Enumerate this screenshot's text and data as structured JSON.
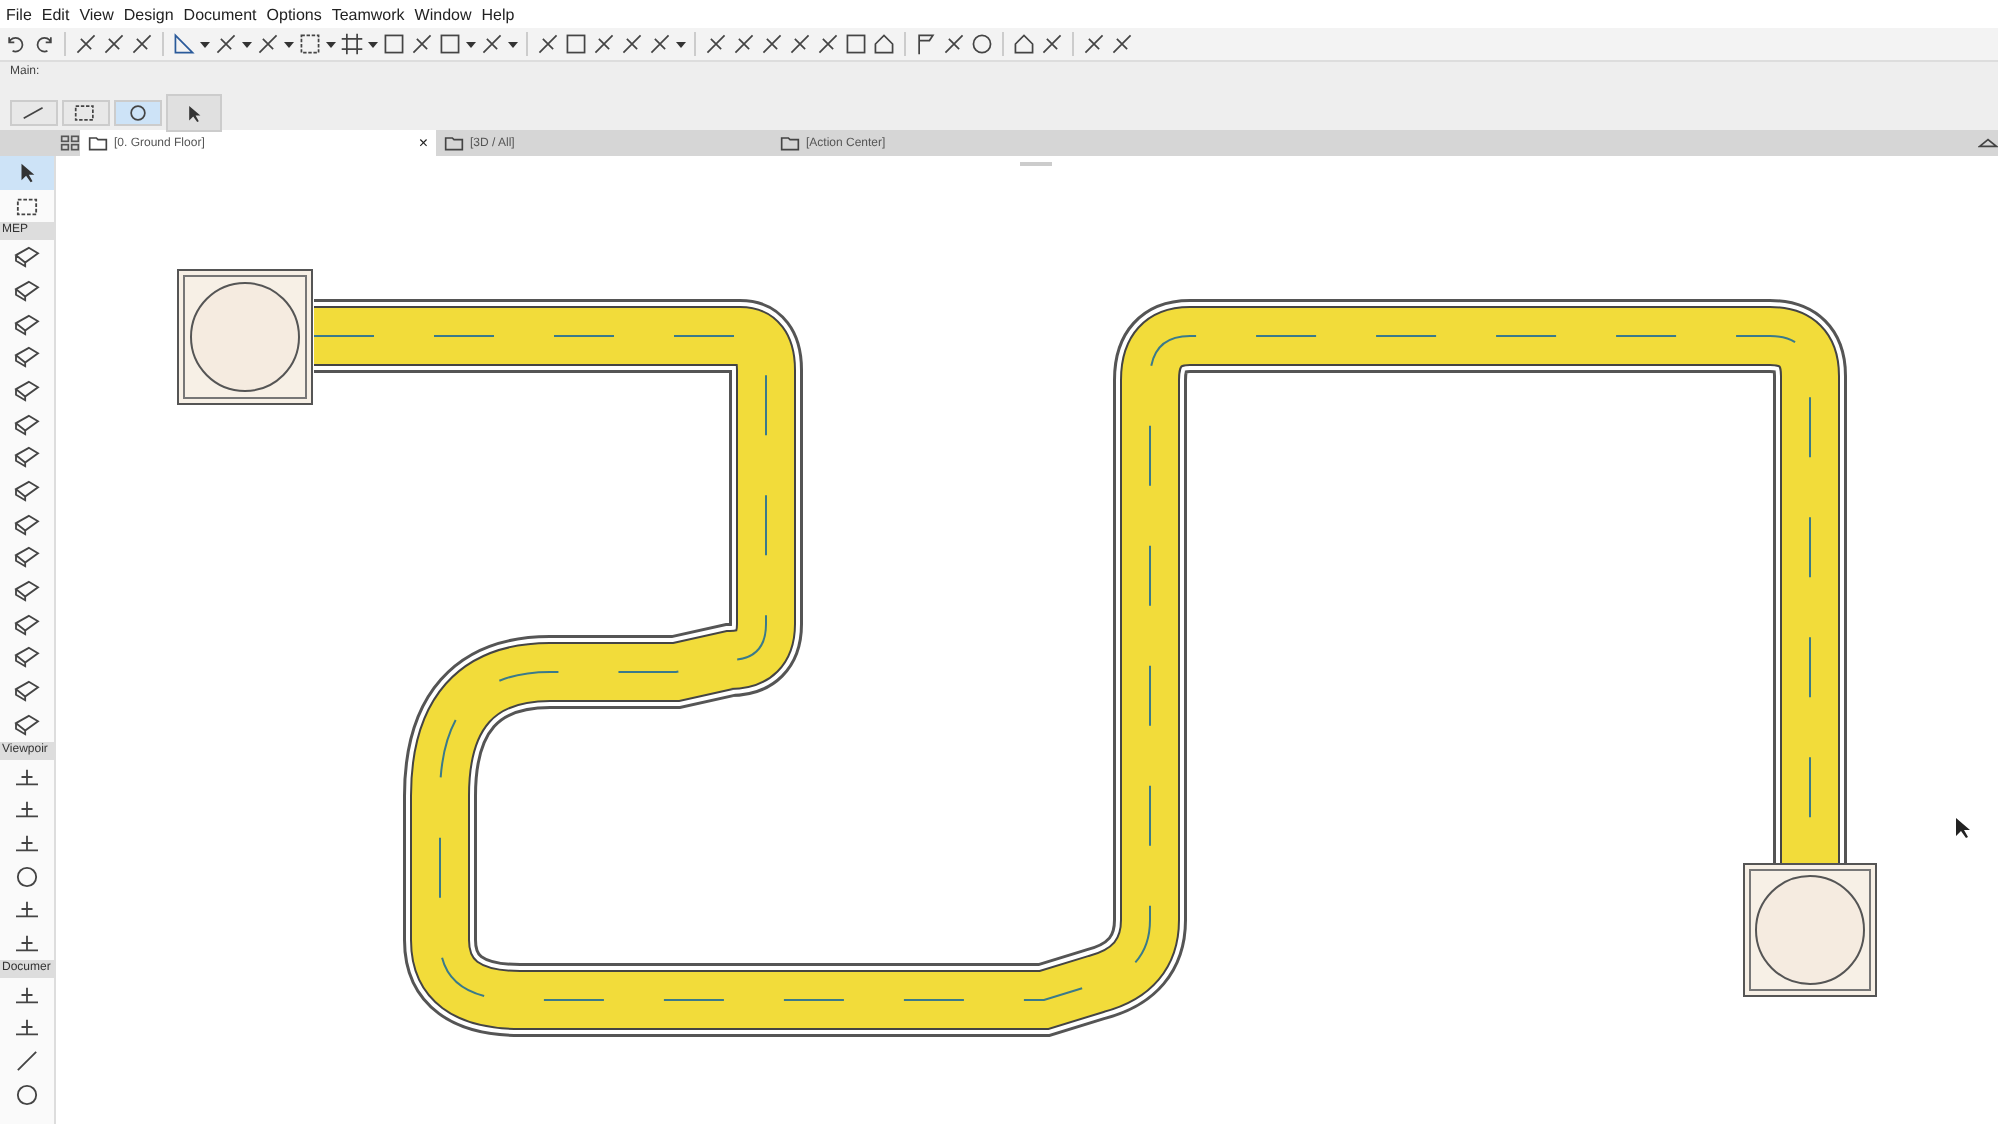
{
  "menu": [
    "File",
    "Edit",
    "View",
    "Design",
    "Document",
    "Options",
    "Teamwork",
    "Window",
    "Help"
  ],
  "main_panel": {
    "label": "Main:"
  },
  "tabs": [
    {
      "label": "[0. Ground Floor]",
      "selected": true,
      "close": "×"
    },
    {
      "label": "[3D / All]",
      "selected": false
    },
    {
      "label": "[Action Center]",
      "selected": false
    }
  ],
  "toolbox": [
    {
      "label": "MEP"
    },
    {
      "label": "Viewpoir"
    },
    {
      "label": "Documer"
    }
  ]
}
